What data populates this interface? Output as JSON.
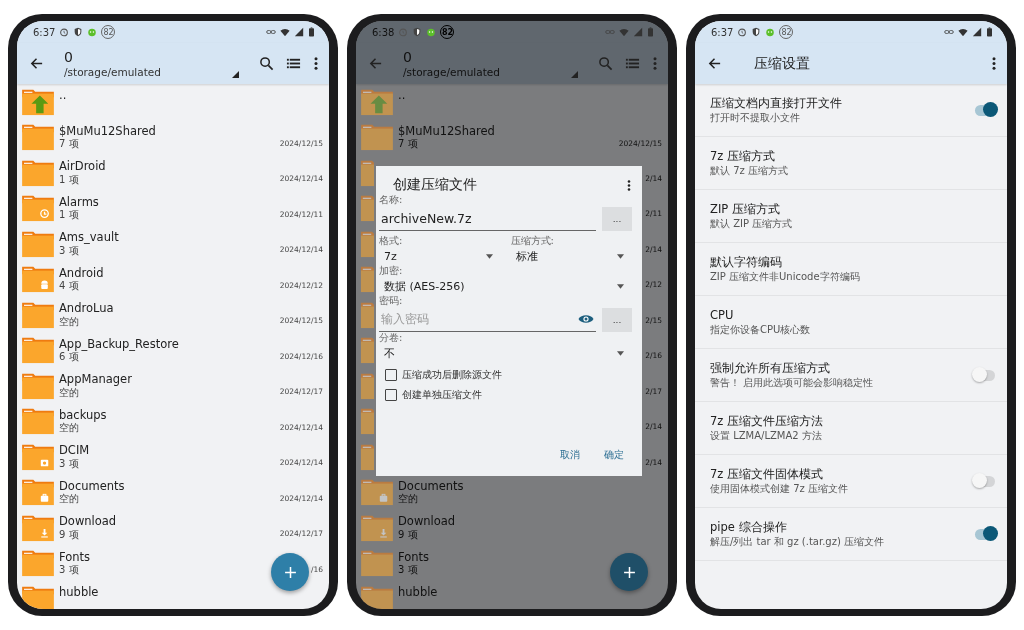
{
  "file_browser": {
    "status_bar": {
      "time": "6:37",
      "badge": "82"
    },
    "app_bar": {
      "title": "0",
      "subtitle": "/storage/emulated"
    },
    "rows": [
      {
        "kind": "parent",
        "name": ".."
      },
      {
        "kind": "folder",
        "name": "$MuMu12Shared",
        "sub": "7 项",
        "date": "2024/12/15"
      },
      {
        "kind": "folder",
        "name": "AirDroid",
        "sub": "1 项",
        "date": "2024/12/14"
      },
      {
        "kind": "alarm",
        "name": "Alarms",
        "sub": "1 项",
        "date": "2024/12/11"
      },
      {
        "kind": "folder",
        "name": "Ams_vault",
        "sub": "3 项",
        "date": "2024/12/14"
      },
      {
        "kind": "android",
        "name": "Android",
        "sub": "4 项",
        "date": "2024/12/12"
      },
      {
        "kind": "folder",
        "name": "AndroLua",
        "sub": "空的",
        "date": "2024/12/15"
      },
      {
        "kind": "folder",
        "name": "App_Backup_Restore",
        "sub": "6 项",
        "date": "2024/12/16"
      },
      {
        "kind": "folder",
        "name": "AppManager",
        "sub": "空的",
        "date": "2024/12/17"
      },
      {
        "kind": "folder",
        "name": "backups",
        "sub": "空的",
        "date": "2024/12/14"
      },
      {
        "kind": "camera",
        "name": "DCIM",
        "sub": "3 项",
        "date": "2024/12/14"
      },
      {
        "kind": "briefcase",
        "name": "Documents",
        "sub": "空的",
        "date": "2024/12/14"
      },
      {
        "kind": "download",
        "name": "Download",
        "sub": "9 项",
        "date": "2024/12/17"
      },
      {
        "kind": "folder",
        "name": "Fonts",
        "sub": "3 项",
        "date": "/16"
      },
      {
        "kind": "folder",
        "name": "hubble"
      }
    ]
  },
  "archive_screen": {
    "status_bar": {
      "time": "6:38",
      "badge": "82"
    },
    "app_bar": {
      "title": "0",
      "subtitle": "/storage/emulated"
    },
    "rows": [
      {
        "kind": "parent",
        "name": ".."
      },
      {
        "kind": "folder",
        "name": "$MuMu12Shared",
        "sub": "7 项",
        "date": "2024/12/15"
      },
      {
        "kind": "folder",
        "date": "2/14"
      },
      {
        "kind": "alarm",
        "date": "2/11"
      },
      {
        "kind": "folder",
        "date": "2/14"
      },
      {
        "kind": "android",
        "date": "2/12"
      },
      {
        "kind": "folder",
        "date": "2/15"
      },
      {
        "kind": "folder",
        "date": "2/16"
      },
      {
        "kind": "folder",
        "date": "2/17"
      },
      {
        "kind": "folder",
        "date": "2/14"
      },
      {
        "kind": "camera",
        "date": "2/14"
      },
      {
        "kind": "briefcase",
        "name": "Documents",
        "sub": "空的"
      },
      {
        "kind": "download",
        "name": "Download",
        "sub": "9 项"
      },
      {
        "kind": "folder",
        "name": "Fonts",
        "sub": "3 项"
      },
      {
        "kind": "folder",
        "name": "hubble"
      }
    ],
    "dialog": {
      "title": "创建压缩文件",
      "name_label": "名称:",
      "name_value": "archiveNew.7z",
      "name_button": "...",
      "format_label": "格式:",
      "format_value": "7z",
      "method_label": "压缩方式:",
      "method_value": "标准",
      "encryption_label": "加密:",
      "encryption_value": "数据 (AES-256)",
      "password_label": "密码:",
      "password_placeholder": "输入密码",
      "password_button": "...",
      "split_label": "分卷:",
      "split_value": "不",
      "checkboxes": [
        {
          "label": "压缩成功后删除源文件",
          "checked": false
        },
        {
          "label": "创建单独压缩文件",
          "checked": false
        }
      ],
      "buttons": [
        "取消",
        "确定"
      ]
    }
  },
  "settings_screen": {
    "status_bar": {
      "time": "6:37",
      "badge": "82"
    },
    "app_bar": {
      "title": "压缩设置"
    },
    "items": [
      {
        "kind": "toggle",
        "title": "压缩文档内直接打开文件",
        "summary": "打开时不提取小文件",
        "on": true
      },
      {
        "kind": "plain",
        "title": "7z 压缩方式",
        "summary": "默认 7z 压缩方式"
      },
      {
        "kind": "plain",
        "title": "ZIP 压缩方式",
        "summary": "默认 ZIP 压缩方式"
      },
      {
        "kind": "plain",
        "title": "默认字符编码",
        "summary": "ZIP 压缩文件非Unicode字符编码"
      },
      {
        "kind": "plain",
        "title": "CPU",
        "summary": "指定你设备CPU核心数"
      },
      {
        "kind": "toggle",
        "title": "强制允许所有压缩方式",
        "summary": "警告！ 启用此选项可能会影响稳定性",
        "on": false
      },
      {
        "kind": "plain",
        "title": "7z 压缩文件压缩方法",
        "summary": "设置 LZMA/LZMA2 方法"
      },
      {
        "kind": "toggle",
        "title": "7z 压缩文件固体模式",
        "summary": "使用固体模式创建 7z 压缩文件",
        "on": false
      },
      {
        "kind": "toggle",
        "title": "pipe 综合操作",
        "summary": "解压/列出 tar 和 gz (.tar.gz) 压缩文件",
        "on": true
      }
    ]
  }
}
